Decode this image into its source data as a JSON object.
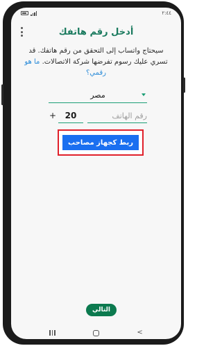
{
  "status_bar": {
    "time": "٢:٤٤",
    "battery_icon": "battery-icon",
    "signal_icon": "signal-icon"
  },
  "header": {
    "title": "أدخل رقم هاتفك",
    "menu_icon": "more-vert-icon"
  },
  "description": {
    "text": "سيحتاج واتساب إلى التحقق من رقم هاتفك. قد تسري عليك رسوم تفرضها شركة الاتصالات.",
    "link": "ما هو رقمي؟"
  },
  "country": {
    "selected": "مصر"
  },
  "phone_input": {
    "plus_sign": "+",
    "country_code": "20",
    "placeholder": "رقم الهاتف",
    "value": ""
  },
  "link_device_button": {
    "label": "ربط كجهاز مصاحب",
    "highlight_color": "#e0202a"
  },
  "next_button": {
    "label": "التالي"
  },
  "colors": {
    "brand": "#1a7a5e",
    "accent_line": "#1a9e75",
    "primary_button": "#1a6ff0",
    "next_button": "#0c7a4f",
    "link": "#2a8bd8"
  },
  "nav_bar": {
    "icons": [
      "recents-icon",
      "home-icon",
      "back-icon"
    ]
  }
}
